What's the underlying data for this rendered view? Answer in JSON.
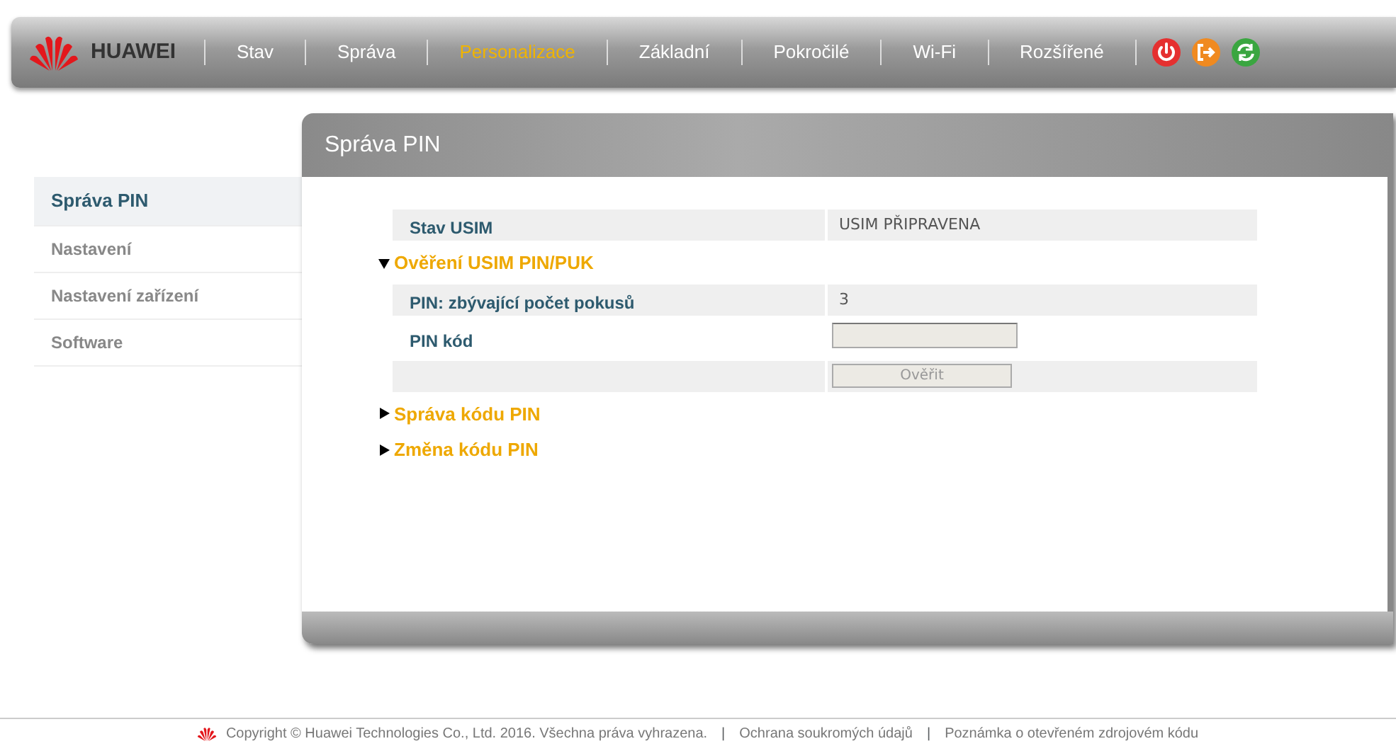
{
  "header": {
    "brand": "HUAWEI",
    "nav": [
      {
        "label": "Stav",
        "selected": false
      },
      {
        "label": "Správa",
        "selected": false
      },
      {
        "label": "Personalizace",
        "selected": true
      },
      {
        "label": "Základní",
        "selected": false
      },
      {
        "label": "Pokročilé",
        "selected": false
      },
      {
        "label": "Wi-Fi",
        "selected": false
      },
      {
        "label": "Rozšířené",
        "selected": false
      }
    ]
  },
  "sidebar": {
    "items": [
      {
        "label": "Správa PIN",
        "selected": true
      },
      {
        "label": "Nastavení",
        "selected": false
      },
      {
        "label": "Nastavení zařízení",
        "selected": false
      },
      {
        "label": "Software",
        "selected": false
      }
    ]
  },
  "panel": {
    "title": "Správa PIN",
    "status": {
      "label": "Stav USIM",
      "value": "USIM PŘIPRAVENA"
    },
    "sections": [
      {
        "title": "Ověření USIM PIN/PUK",
        "expanded": true,
        "rows": [
          {
            "kind": "text",
            "label": "PIN: zbývající počet pokusů",
            "value": "3"
          },
          {
            "kind": "input",
            "label": "PIN kód"
          },
          {
            "kind": "button",
            "button": "Ověřit",
            "disabled": true
          }
        ]
      },
      {
        "title": "Správa kódu PIN",
        "expanded": false
      },
      {
        "title": "Změna kódu PIN",
        "expanded": false
      }
    ]
  },
  "footer": {
    "copyright": "Copyright © Huawei Technologies Co., Ltd. 2016. Všechna práva vyhrazena.",
    "separator": "|",
    "links": [
      "Ochrana soukromých údajů",
      "Poznámka o otevřeném zdrojovém kódu"
    ]
  }
}
